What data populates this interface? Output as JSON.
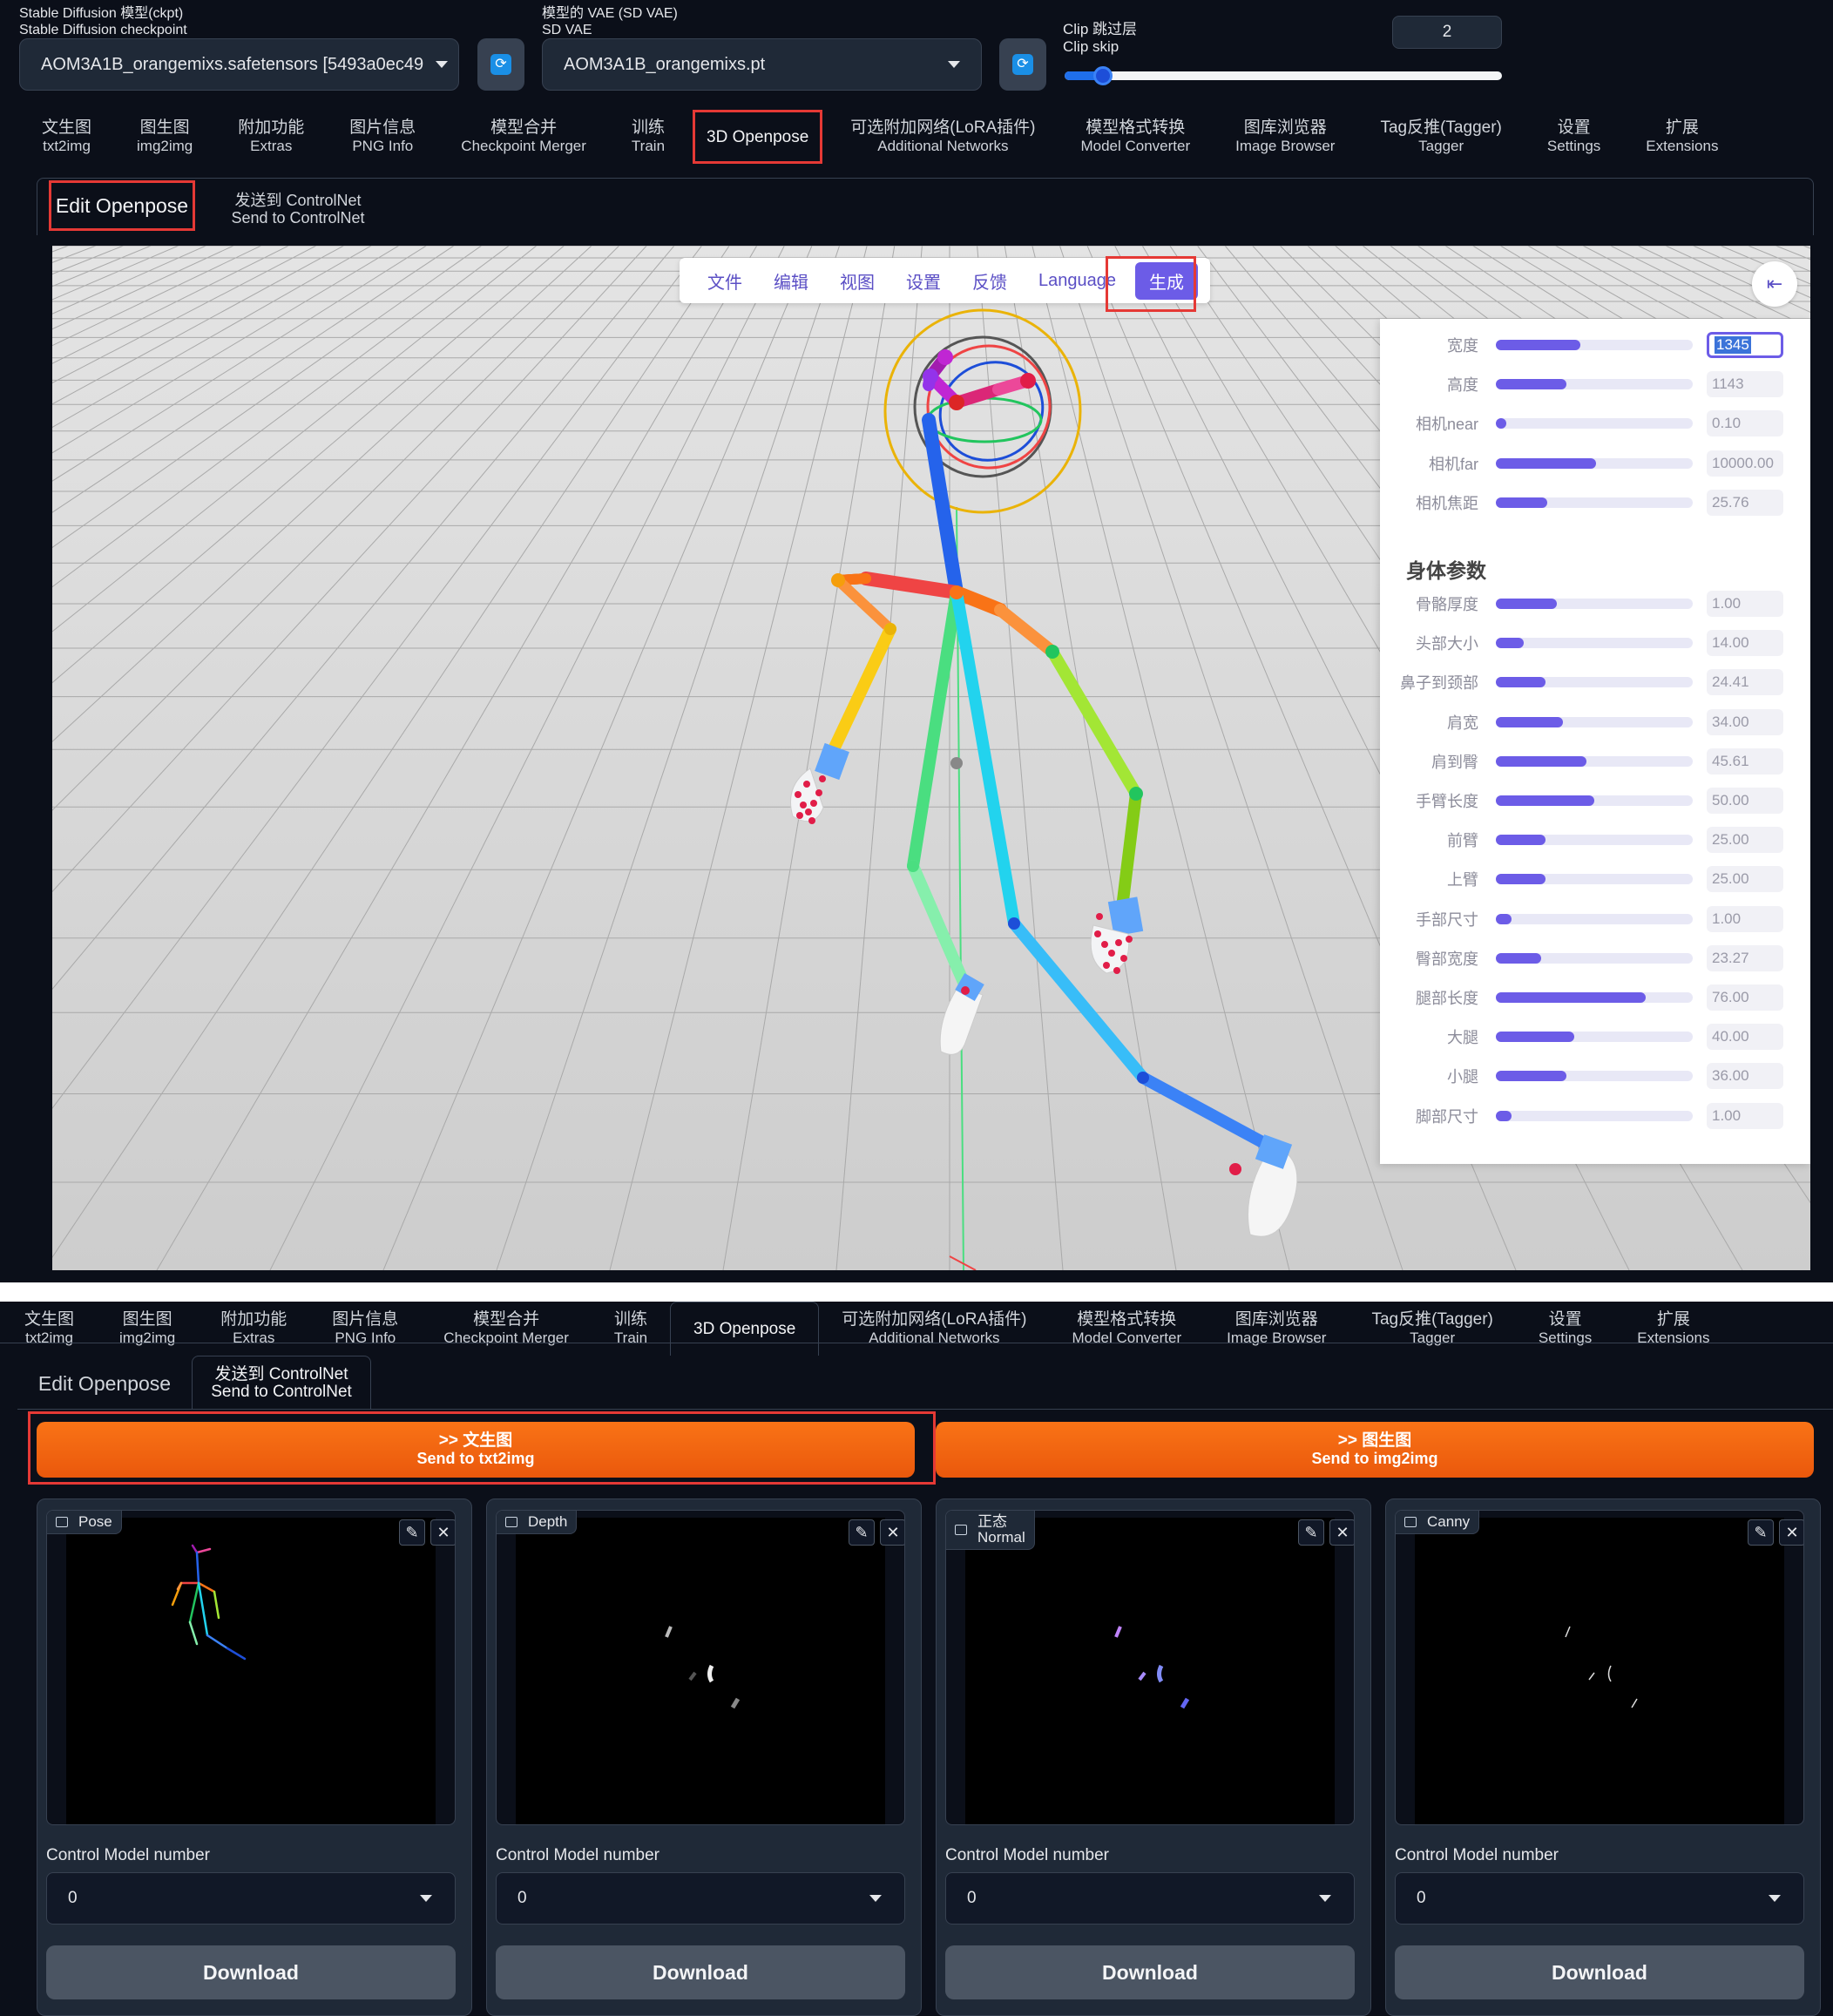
{
  "top": {
    "ckpt_label_1": "Stable Diffusion 模型(ckpt)",
    "ckpt_label_2": "Stable Diffusion checkpoint",
    "ckpt_value": "AOM3A1B_orangemixs.safetensors [5493a0ec49",
    "vae_label_1": "模型的 VAE (SD VAE)",
    "vae_label_2": "SD VAE",
    "vae_value": "AOM3A1B_orangemixs.pt",
    "clip_label_1": "Clip 跳过层",
    "clip_label_2": "Clip skip",
    "clip_value": "2",
    "clip_fraction": 0.07
  },
  "tabs": [
    {
      "l1": "文生图",
      "l2": "txt2img"
    },
    {
      "l1": "图生图",
      "l2": "img2img"
    },
    {
      "l1": "附加功能",
      "l2": "Extras"
    },
    {
      "l1": "图片信息",
      "l2": "PNG Info"
    },
    {
      "l1": "模型合并",
      "l2": "Checkpoint Merger"
    },
    {
      "l1": "训练",
      "l2": "Train"
    },
    {
      "l1": "3D Openpose",
      "l2": ""
    },
    {
      "l1": "可选附加网络(LoRA插件)",
      "l2": "Additional Networks"
    },
    {
      "l1": "模型格式转换",
      "l2": "Model Converter"
    },
    {
      "l1": "图库浏览器",
      "l2": "Image Browser"
    },
    {
      "l1": "Tag反推(Tagger)",
      "l2": "Tagger"
    },
    {
      "l1": "设置",
      "l2": "Settings"
    },
    {
      "l1": "扩展",
      "l2": "Extensions"
    }
  ],
  "subtabs": {
    "edit": "Edit Openpose",
    "send_1": "发送到 ControlNet",
    "send_2": "Send to ControlNet"
  },
  "menu": {
    "file": "文件",
    "edit": "编辑",
    "view": "视图",
    "settings": "设置",
    "feedback": "反馈",
    "language": "Language",
    "generate": "生成"
  },
  "collapse_icon": "collapse-left-icon",
  "panel": {
    "camera": [
      {
        "label": "宽度",
        "value": "1345",
        "fraction": 0.43
      },
      {
        "label": "高度",
        "value": "1143",
        "fraction": 0.36
      },
      {
        "label": "相机near",
        "value": "0.10",
        "fraction": 0.0
      },
      {
        "label": "相机far",
        "value": "10000.00",
        "fraction": 0.51
      },
      {
        "label": "相机焦距",
        "value": "25.76",
        "fraction": 0.26
      }
    ],
    "body_title": "身体参数",
    "body": [
      {
        "label": "骨骼厚度",
        "value": "1.00",
        "fraction": 0.31
      },
      {
        "label": "头部大小",
        "value": "14.00",
        "fraction": 0.14
      },
      {
        "label": "鼻子到颈部",
        "value": "24.41",
        "fraction": 0.25
      },
      {
        "label": "肩宽",
        "value": "34.00",
        "fraction": 0.34
      },
      {
        "label": "肩到臀",
        "value": "45.61",
        "fraction": 0.46
      },
      {
        "label": "手臂长度",
        "value": "50.00",
        "fraction": 0.5
      },
      {
        "label": "前臂",
        "value": "25.00",
        "fraction": 0.25
      },
      {
        "label": "上臂",
        "value": "25.00",
        "fraction": 0.25
      },
      {
        "label": "手部尺寸",
        "value": "1.00",
        "fraction": 0.08
      },
      {
        "label": "臀部宽度",
        "value": "23.27",
        "fraction": 0.23
      },
      {
        "label": "腿部长度",
        "value": "76.00",
        "fraction": 0.76
      },
      {
        "label": "大腿",
        "value": "40.00",
        "fraction": 0.4
      },
      {
        "label": "小腿",
        "value": "36.00",
        "fraction": 0.36
      },
      {
        "label": "脚部尺寸",
        "value": "1.00",
        "fraction": 0.08
      }
    ]
  },
  "send": {
    "txt2img_1": ">> 文生图",
    "txt2img_2": "Send to txt2img",
    "img2img_1": ">> 图生图",
    "img2img_2": "Send to img2img"
  },
  "cards": [
    {
      "label_1": "Pose",
      "label_2": "",
      "cm_label": "Control Model number",
      "cm_value": "0",
      "download": "Download"
    },
    {
      "label_1": "Depth",
      "label_2": "",
      "cm_label": "Control Model number",
      "cm_value": "0",
      "download": "Download"
    },
    {
      "label_1": "正态",
      "label_2": "Normal",
      "cm_label": "Control Model number",
      "cm_value": "0",
      "download": "Download"
    },
    {
      "label_1": "Canny",
      "label_2": "",
      "cm_label": "Control Model number",
      "cm_value": "0",
      "download": "Download"
    }
  ],
  "colors": {
    "accent": "#6c5ce7",
    "orange": "#f97316",
    "highlight": "#e53935"
  }
}
